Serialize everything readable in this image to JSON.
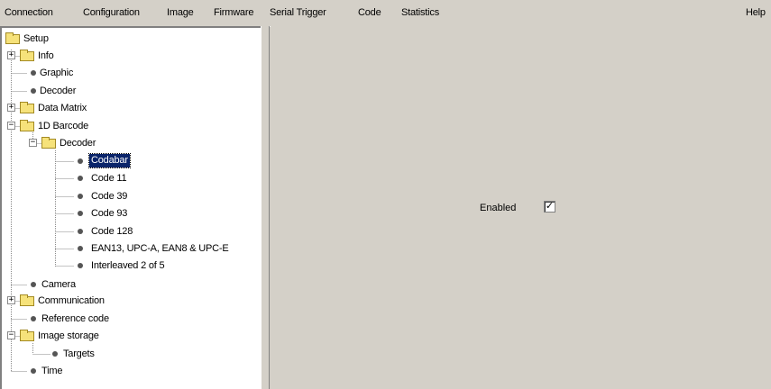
{
  "menu": {
    "connection": "Connection",
    "configuration": "Configuration",
    "image": "Image",
    "firmware": "Firmware",
    "serial_trigger": "Serial Trigger",
    "code": "Code",
    "statistics": "Statistics",
    "help": "Help"
  },
  "tree": {
    "setup": "Setup",
    "info": "Info",
    "graphic": "Graphic",
    "decoder": "Decoder",
    "data_matrix": "Data Matrix",
    "barcode_1d": "1D Barcode",
    "barcode_decoder": "Decoder",
    "codabar": "Codabar",
    "code11": "Code 11",
    "code39": "Code 39",
    "code93": "Code 93",
    "code128": "Code 128",
    "ean": "EAN13, UPC-A, EAN8 & UPC-E",
    "interleaved": "Interleaved 2 of 5",
    "camera": "Camera",
    "communication": "Communication",
    "reference_code": "Reference code",
    "image_storage": "Image storage",
    "targets": "Targets",
    "time": "Time",
    "selected": "Codabar"
  },
  "main": {
    "enabled_label": "Enabled",
    "enabled_checked": true,
    "check_glyph": "✓"
  },
  "colors": {
    "selection": "#0a246a",
    "folder": "#f6e27a",
    "background": "#d4d0c8"
  }
}
